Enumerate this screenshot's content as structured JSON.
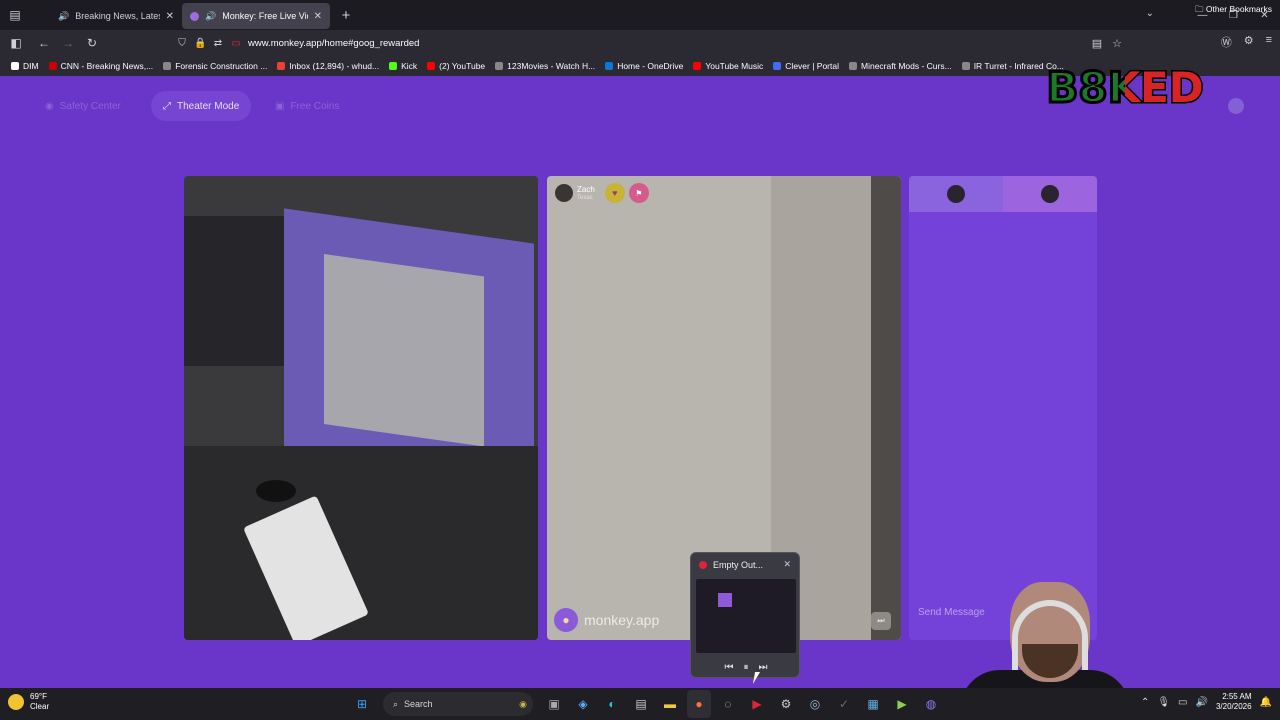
{
  "browser": {
    "tabs": [
      {
        "title": "Breaking News, Latest News",
        "active": false,
        "favicon_color": "#cc0000"
      },
      {
        "title": "Monkey: Free Live Video Chat",
        "active": true,
        "favicon_color": "#9c6ce0"
      }
    ],
    "url": "www.monkey.app/home#goog_rewarded",
    "bookmarks": [
      {
        "label": "DIM",
        "color": "#ffffff"
      },
      {
        "label": "CNN - Breaking News,...",
        "color": "#cc0000"
      },
      {
        "label": "Forensic Construction ...",
        "color": "#888888"
      },
      {
        "label": "Inbox (12,894) - whud...",
        "color": "#ea4335"
      },
      {
        "label": "Kick",
        "color": "#53fc18"
      },
      {
        "label": "(2) YouTube",
        "color": "#ff0000"
      },
      {
        "label": "123Movies - Watch H...",
        "color": "#888888"
      },
      {
        "label": "Home - OneDrive",
        "color": "#0a78d4"
      },
      {
        "label": "YouTube Music",
        "color": "#ff0000"
      },
      {
        "label": "Clever | Portal",
        "color": "#436cf2"
      },
      {
        "label": "Minecraft Mods - Curs...",
        "color": "#888888"
      },
      {
        "label": "IR Turret - Infrared Co...",
        "color": "#888888"
      }
    ],
    "other_bookmarks": "Other Bookmarks"
  },
  "monkey": {
    "top_buttons": {
      "safety": "Safety Center",
      "theater": "Theater Mode",
      "coins": "Free Coins"
    },
    "partner": {
      "name": "Zach",
      "location": "Texas"
    },
    "watermark": "monkey.app",
    "chat_placeholder": "Send Message"
  },
  "media_popup": {
    "title": "Empty Out..."
  },
  "taskbar": {
    "weather_temp": "69°F",
    "weather_desc": "Clear",
    "search_placeholder": "Search",
    "time": "2:55 AM",
    "date": "3/20/2026"
  },
  "colors": {
    "page_bg": "#6a35c9",
    "chat_bg": "#7442d8",
    "accent": "#9c6ce0"
  }
}
